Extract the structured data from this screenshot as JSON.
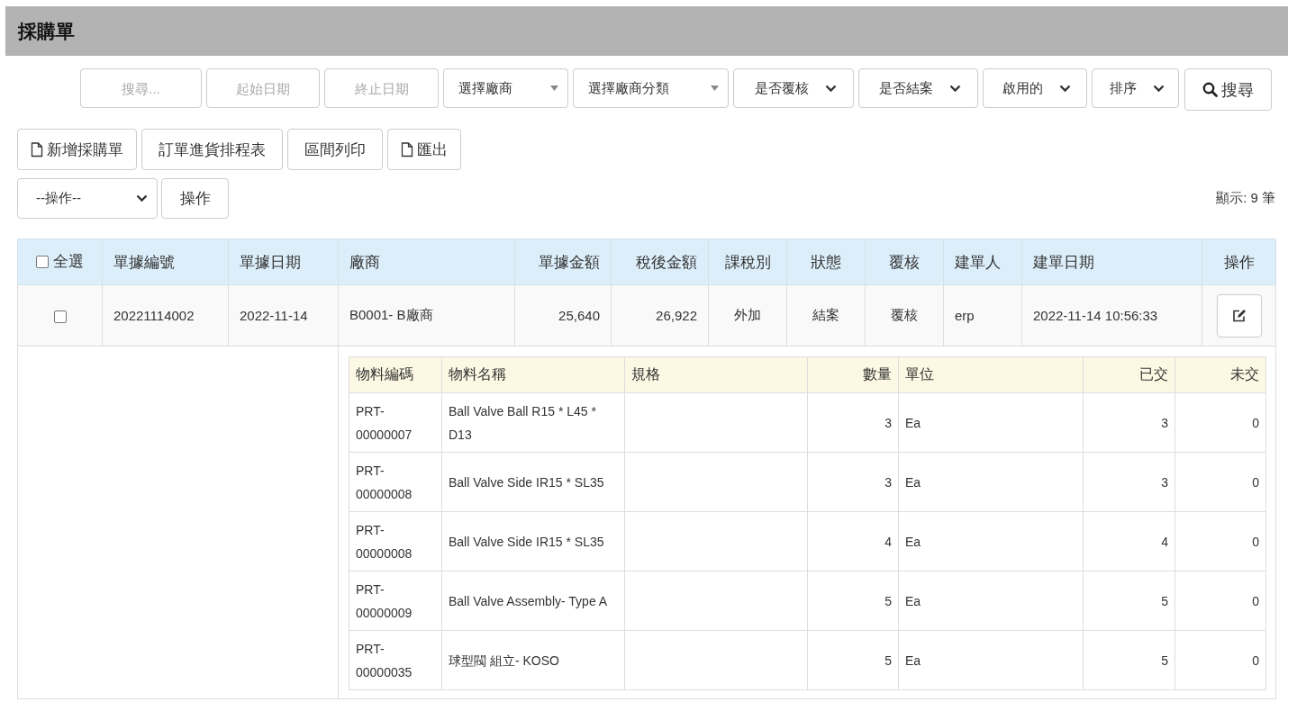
{
  "title": "採購單",
  "filters": [
    {
      "kind": "input",
      "placeholder": "搜尋..."
    },
    {
      "kind": "input",
      "placeholder": "起始日期"
    },
    {
      "kind": "input",
      "placeholder": "終止日期"
    },
    {
      "kind": "combo",
      "value": "選擇廠商"
    },
    {
      "kind": "combo",
      "value": "選擇廠商分類"
    },
    {
      "kind": "select",
      "value": "是否覆核"
    },
    {
      "kind": "select",
      "value": "是否結案"
    },
    {
      "kind": "select",
      "value": "啟用的"
    },
    {
      "kind": "select",
      "value": "排序"
    }
  ],
  "search_button": "搜尋",
  "actions": [
    {
      "label": "新增採購單",
      "kind": "iconic"
    },
    {
      "label": "訂單進貨排程表",
      "kind": "plain"
    },
    {
      "label": "區間列印",
      "kind": "plain"
    },
    {
      "label": "匯出",
      "kind": "iconic"
    }
  ],
  "bulk_select": {
    "value": "--操作--"
  },
  "bulk_button": "操作",
  "count": "顯示: 9 筆",
  "table": {
    "select_all": {
      "label": "全選",
      "checked": false
    },
    "columns": [
      "單據編號",
      "單據日期",
      "廠商",
      "單據金額",
      "稅後金額",
      "課稅別",
      "狀態",
      "覆核",
      "建單人",
      "建單日期",
      "操作"
    ],
    "rows": [
      {
        "checked": false,
        "cells": [
          "20221114002",
          "2022-11-14",
          "B0001- B廠商",
          "25,640",
          "26,922",
          "外加",
          "結案",
          "覆核",
          "erp",
          "2022-11-14 10:56:33"
        ],
        "details": {
          "columns": [
            "物料編碼",
            "物料名稱",
            "規格",
            "數量",
            "單位",
            "已交",
            "未交"
          ],
          "rows": [
            [
              "PRT-00000007",
              "Ball Valve Ball R15 * L45 * D13",
              "",
              "3",
              "Ea",
              "3",
              "0"
            ],
            [
              "PRT-00000008",
              "Ball Valve Side IR15 * SL35",
              "",
              "3",
              "Ea",
              "3",
              "0"
            ],
            [
              "PRT-00000008",
              "Ball Valve Side IR15 * SL35",
              "",
              "4",
              "Ea",
              "4",
              "0"
            ],
            [
              "PRT-00000009",
              "Ball Valve Assembly- Type A",
              "",
              "5",
              "Ea",
              "5",
              "0"
            ],
            [
              "PRT-00000035",
              "球型閥 組立- KOSO",
              "",
              "5",
              "Ea",
              "5",
              "0"
            ]
          ]
        }
      }
    ]
  }
}
